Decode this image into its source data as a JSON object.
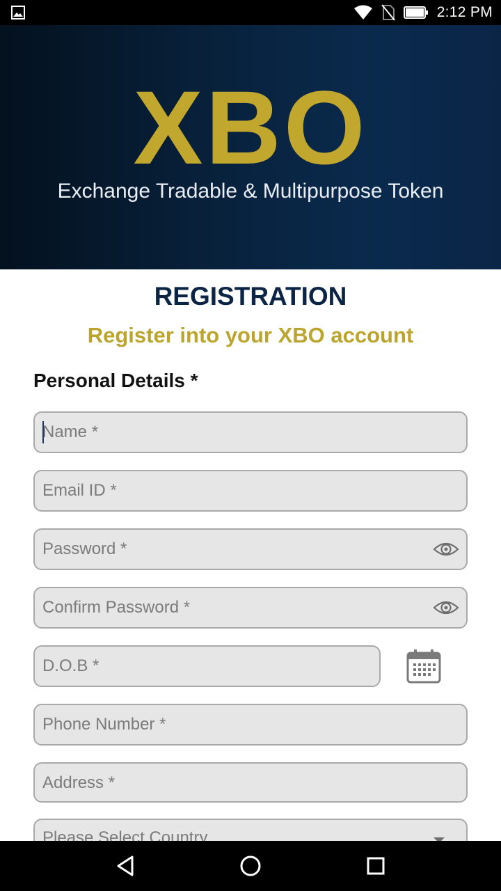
{
  "status_bar": {
    "time": "2:12 PM"
  },
  "header": {
    "logo": "XBO",
    "tagline": "Exchange Tradable & Multipurpose Token"
  },
  "form": {
    "title": "REGISTRATION",
    "subtitle": "Register into your XBO account",
    "section_label": "Personal Details *",
    "fields": {
      "name": "Name *",
      "email": "Email ID *",
      "password": "Password *",
      "confirm_password": "Confirm Password *",
      "dob": "D.O.B *",
      "phone": "Phone Number *",
      "address": "Address *",
      "country": "Please Select Country"
    }
  },
  "colors": {
    "brand_gold": "#c2a72f",
    "navy": "#0d2544",
    "field_bg": "#e6e6e6"
  },
  "icons": [
    "image-icon",
    "wifi-icon",
    "no-sim-icon",
    "battery-icon",
    "eye-icon",
    "calendar-icon",
    "dropdown-arrow-icon",
    "back-icon",
    "home-icon",
    "recents-icon"
  ]
}
